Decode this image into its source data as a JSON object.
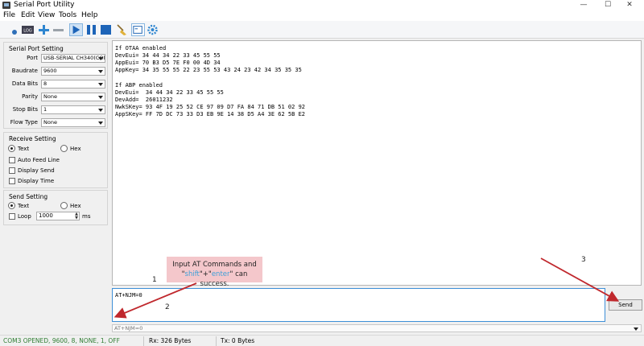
{
  "window": {
    "title": "Serial Port Utility",
    "minimize": "—",
    "maximize": "☐",
    "close": "✕"
  },
  "menu": {
    "file": "File",
    "edit": "Edit",
    "view": "View",
    "tools": "Tools",
    "help": "Help"
  },
  "toolbar": {
    "icons": [
      "settings-dot-icon",
      "log-icon",
      "add-icon",
      "remove-icon",
      "play-icon",
      "pause-icon",
      "stop-icon",
      "clear-broom-icon",
      "window-icon",
      "gear-icon"
    ],
    "log_label": "LOG"
  },
  "serial_settings": {
    "title": "Serial Port Setting",
    "rows": [
      {
        "label": "Port",
        "value": "USB-SERIAL CH340(COM"
      },
      {
        "label": "Baudrate",
        "value": "9600"
      },
      {
        "label": "Data Bits",
        "value": "8"
      },
      {
        "label": "Parity",
        "value": "None"
      },
      {
        "label": "Stop Bits",
        "value": "1"
      },
      {
        "label": "Flow Type",
        "value": "None"
      }
    ]
  },
  "receive_settings": {
    "title": "Receive Setting",
    "text_label": "Text",
    "hex_label": "Hex",
    "selected": "Text",
    "options": [
      {
        "label": "Auto Feed Line",
        "checked": false
      },
      {
        "label": "Display Send",
        "checked": false
      },
      {
        "label": "Display Time",
        "checked": false
      }
    ]
  },
  "send_settings": {
    "title": "Send Setting",
    "text_label": "Text",
    "hex_label": "Hex",
    "selected": "Text",
    "loop_label": "Loop",
    "loop_checked": false,
    "interval": "1000",
    "interval_unit": "ms"
  },
  "output": {
    "lines": [
      "If OTAA enabled",
      "DevEui= 34 44 34 22 33 45 55 55",
      "AppEui= 70 B3 D5 7E F0 00 4D 34",
      "AppKey= 34 35 55 55 22 23 55 53 43 24 23 42 34 35 35 35",
      "",
      "If ABP enabled",
      "DevEui=  34 44 34 22 33 45 55 55",
      "DevAdd=  26011232",
      "NwkSKey= 93 4F 19 25 52 CE 97 09 D7 FA 84 71 DB 51 02 92",
      "AppSKey= FF 7D DC 73 33 D3 EB 9E 14 38 D5 A4 3E 62 5B E2"
    ]
  },
  "input": {
    "value": "AT+NJM=0"
  },
  "send": {
    "label": "Send"
  },
  "history": {
    "value": "AT+NJM=0"
  },
  "status": {
    "connection": "COM3 OPENED, 9600, 8, NONE, 1, OFF",
    "rx": "Rx: 326 Bytes",
    "tx": "Tx: 0 Bytes"
  },
  "annotation": {
    "callout_line1": "Input AT Commands and",
    "callout_q1": "\"",
    "callout_shift": "shift",
    "callout_plus": "\"+\"",
    "callout_enter": "enter",
    "callout_tail": "\" can success.",
    "step1": "1",
    "step2": "2",
    "step3": "3"
  },
  "colors": {
    "status_text": "#2e7d32",
    "input_border": "#3d8fd7",
    "callout_bg": "#f4c7cb",
    "arrow": "#c0282d",
    "highlight": "#3ea0d8"
  }
}
